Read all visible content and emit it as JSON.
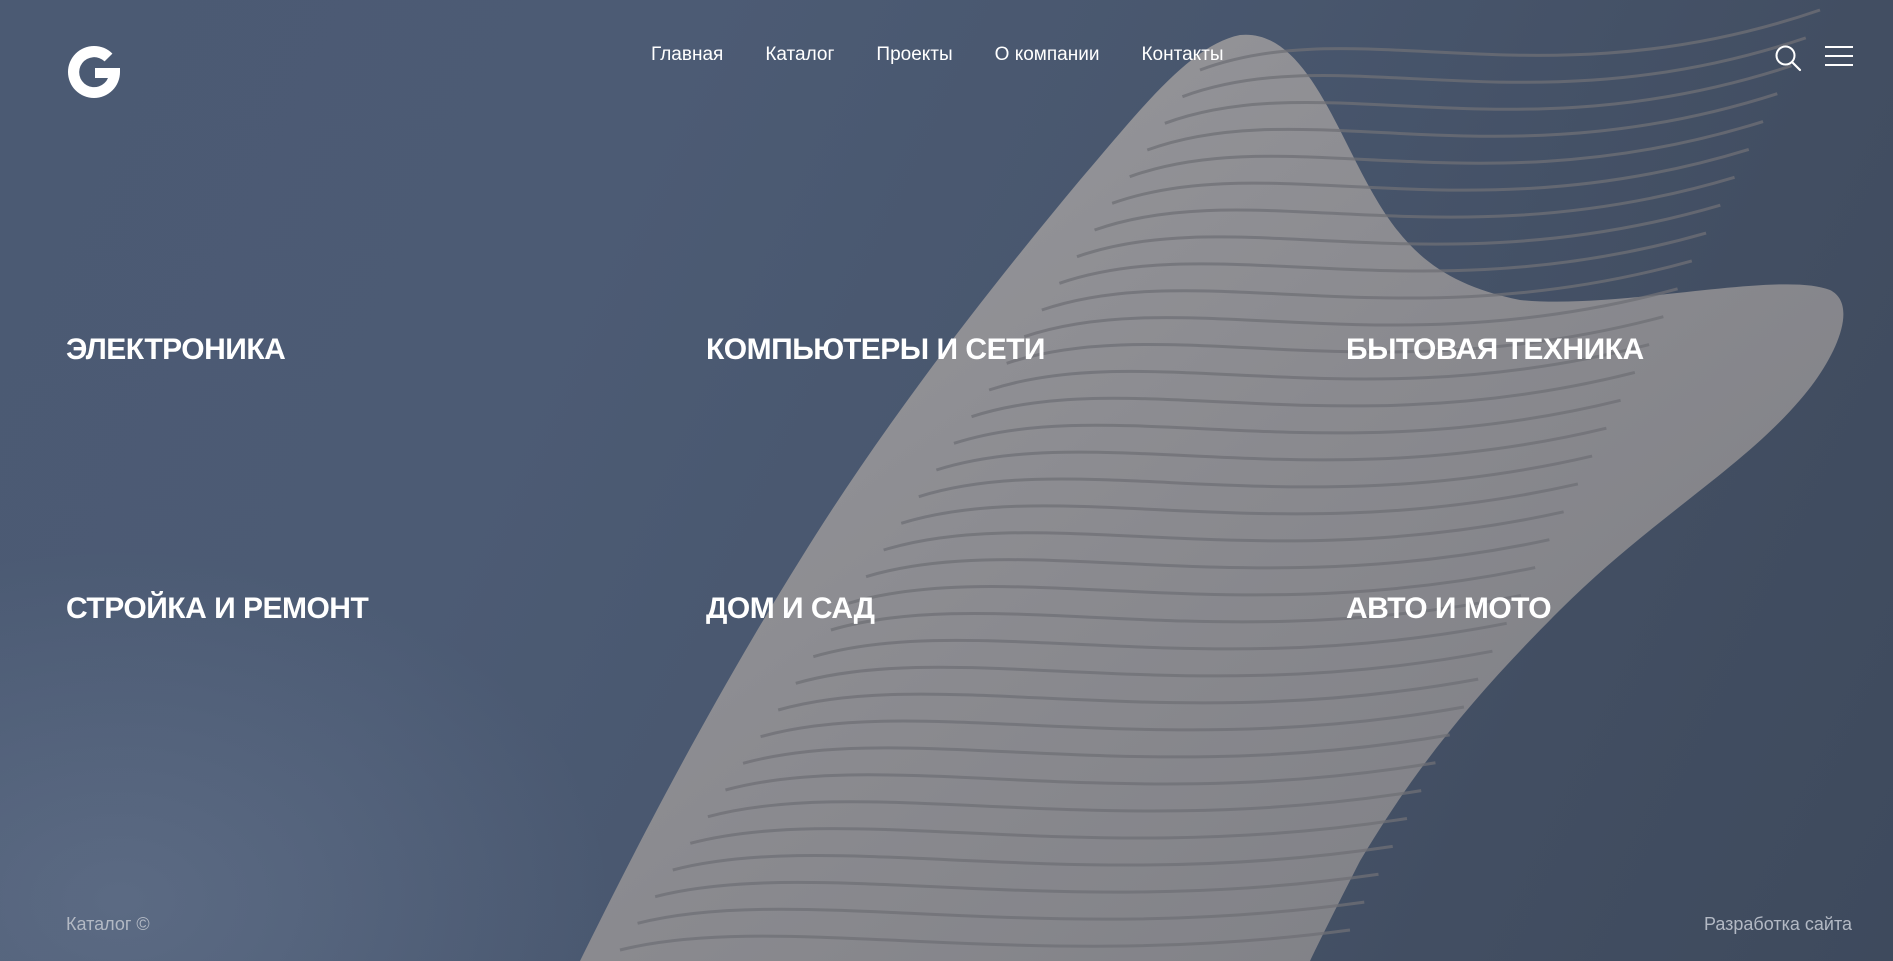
{
  "header": {
    "logo_icon": "g-logo-icon",
    "nav": [
      {
        "label": "Главная"
      },
      {
        "label": "Каталог"
      },
      {
        "label": "Проекты"
      },
      {
        "label": "О компании"
      },
      {
        "label": "Контакты"
      }
    ],
    "search_icon": "search-icon",
    "menu_icon": "hamburger-menu-icon"
  },
  "categories": [
    {
      "label": "ЭЛЕКТРОНИКА"
    },
    {
      "label": "КОМПЬЮТЕРЫ И СЕТИ"
    },
    {
      "label": "БЫТОВАЯ ТЕХНИКА"
    },
    {
      "label": "СТРОЙКА И РЕМОНТ"
    },
    {
      "label": "ДОМ И САД"
    },
    {
      "label": "АВТО И МОТО"
    }
  ],
  "footer": {
    "left_text": "Каталог ©",
    "right_text": "Разработка сайта"
  },
  "colors": {
    "background": "#4a586f",
    "text": "#ffffff",
    "footer_text": "#b3b9c4",
    "sculpture": "#8c8c91"
  }
}
